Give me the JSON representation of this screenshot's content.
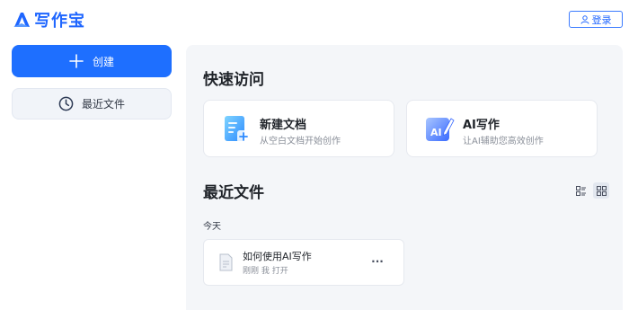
{
  "app": {
    "name": "写作宝",
    "brand_color": "#1f66ff"
  },
  "header": {
    "login_label": "登录",
    "login_icon": "user-icon"
  },
  "sidebar": {
    "create_label": "创建",
    "create_icon": "plus-icon",
    "recent_label": "最近文件",
    "recent_icon": "clock-icon"
  },
  "quick_access": {
    "title": "快速访问",
    "cards": [
      {
        "title": "新建文档",
        "subtitle": "从空白文档开始创作",
        "icon": "new-document-icon"
      },
      {
        "title": "AI写作",
        "subtitle": "让AI辅助您高效创作",
        "icon": "ai-pen-icon"
      }
    ]
  },
  "recent": {
    "title": "最近文件",
    "view_modes": [
      "list-view-icon",
      "grid-view-icon"
    ],
    "active_view": "grid",
    "groups": [
      {
        "label": "今天",
        "files": [
          {
            "name": "如何使用AI写作",
            "meta": "刚刚 我 打开",
            "icon": "document-icon",
            "more_icon": "more-icon",
            "more_label": "···"
          }
        ]
      }
    ]
  }
}
